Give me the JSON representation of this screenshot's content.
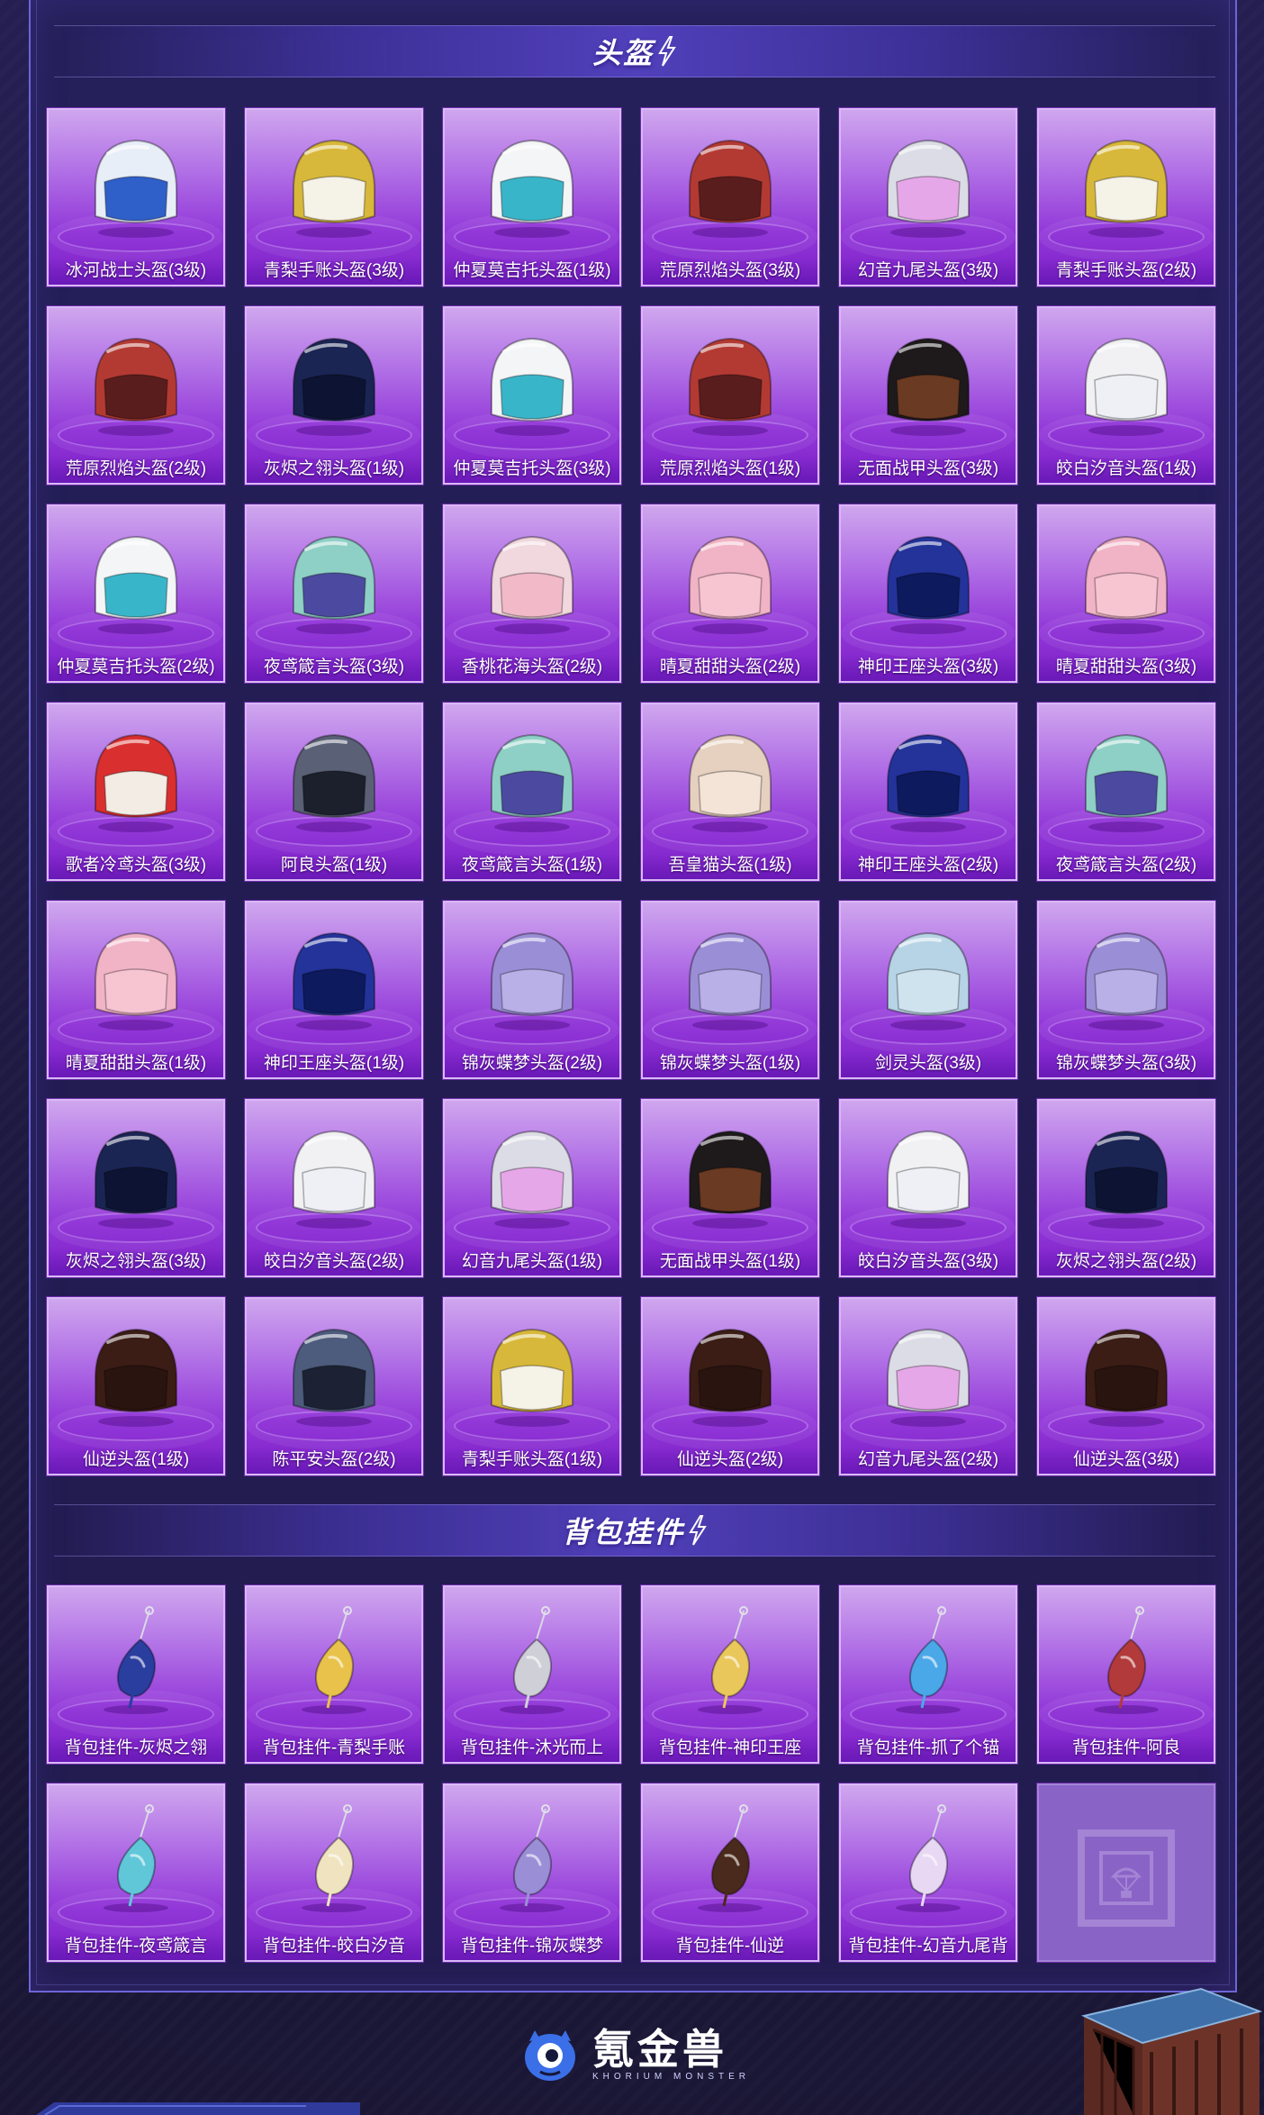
{
  "sections": {
    "helmets": {
      "title": "头盔",
      "items": [
        {
          "label": "冰河战士头盔(3级)",
          "icon": "helmet-icon",
          "color": "#2f5fc8",
          "shell": "#e8eef7"
        },
        {
          "label": "青梨手账头盔(3级)",
          "icon": "helmet-icon",
          "color": "#f5f2e8",
          "shell": "#d8b83a"
        },
        {
          "label": "仲夏莫吉托头盔(1级)",
          "icon": "helmet-icon",
          "color": "#39b5c9",
          "shell": "#f4f5f7"
        },
        {
          "label": "荒原烈焰头盔(3级)",
          "icon": "helmet-icon",
          "color": "#5a1d1d",
          "shell": "#b33a33"
        },
        {
          "label": "幻音九尾头盔(3级)",
          "icon": "helmet-icon",
          "color": "#e6a7e9",
          "shell": "#dcdce6"
        },
        {
          "label": "青梨手账头盔(2级)",
          "icon": "helmet-icon",
          "color": "#f5f2e8",
          "shell": "#d8b83a"
        },
        {
          "label": "荒原烈焰头盔(2级)",
          "icon": "helmet-icon",
          "color": "#5a1d1d",
          "shell": "#b33a33"
        },
        {
          "label": "灰烬之翎头盔(1级)",
          "icon": "helmet-icon",
          "color": "#0d1433",
          "shell": "#1b2554"
        },
        {
          "label": "仲夏莫吉托头盔(3级)",
          "icon": "helmet-icon",
          "color": "#39b5c9",
          "shell": "#f4f5f7"
        },
        {
          "label": "荒原烈焰头盔(1级)",
          "icon": "helmet-icon",
          "color": "#5a1d1d",
          "shell": "#b33a33"
        },
        {
          "label": "无面战甲头盔(3级)",
          "icon": "helmet-icon",
          "color": "#6b3a22",
          "shell": "#1e1a1c"
        },
        {
          "label": "皎白汐音头盔(1级)",
          "icon": "helmet-icon",
          "color": "#eef0f6",
          "shell": "#f1f1f4"
        },
        {
          "label": "仲夏莫吉托头盔(2级)",
          "icon": "helmet-icon",
          "color": "#39b5c9",
          "shell": "#f4f5f7"
        },
        {
          "label": "夜鸢箴言头盔(3级)",
          "icon": "helmet-icon",
          "color": "#4b4aa0",
          "shell": "#8fd0c6"
        },
        {
          "label": "香桃花海头盔(2级)",
          "icon": "helmet-icon",
          "color": "#f2b9c8",
          "shell": "#f1d7de"
        },
        {
          "label": "晴夏甜甜头盔(2级)",
          "icon": "helmet-icon",
          "color": "#f7c4d2",
          "shell": "#f1b3c6"
        },
        {
          "label": "神印王座头盔(3级)",
          "icon": "helmet-icon",
          "color": "#0d1a5e",
          "shell": "#23339a"
        },
        {
          "label": "晴夏甜甜头盔(3级)",
          "icon": "helmet-icon",
          "color": "#f7c4d2",
          "shell": "#f1b3c6"
        },
        {
          "label": "歌者冷鸢头盔(3级)",
          "icon": "helmet-icon",
          "color": "#f2ece4",
          "shell": "#d9302f"
        },
        {
          "label": "阿良头盔(1级)",
          "icon": "helmet-icon",
          "color": "#1c1f2c",
          "shell": "#5a6075"
        },
        {
          "label": "夜鸢箴言头盔(1级)",
          "icon": "helmet-icon",
          "color": "#4b4aa0",
          "shell": "#8fd0c6"
        },
        {
          "label": "吾皇猫头盔(1级)",
          "icon": "helmet-icon",
          "color": "#f4e4d8",
          "shell": "#e6d0bf"
        },
        {
          "label": "神印王座头盔(2级)",
          "icon": "helmet-icon",
          "color": "#0d1a5e",
          "shell": "#23339a"
        },
        {
          "label": "夜鸢箴言头盔(2级)",
          "icon": "helmet-icon",
          "color": "#4b4aa0",
          "shell": "#8fd0c6"
        },
        {
          "label": "晴夏甜甜头盔(1级)",
          "icon": "helmet-icon",
          "color": "#f7c4d2",
          "shell": "#f1b3c6"
        },
        {
          "label": "神印王座头盔(1级)",
          "icon": "helmet-icon",
          "color": "#0d1a5e",
          "shell": "#23339a"
        },
        {
          "label": "锦灰蝶梦头盔(2级)",
          "icon": "helmet-icon",
          "color": "#b9b0e8",
          "shell": "#9a8fd6"
        },
        {
          "label": "锦灰蝶梦头盔(1级)",
          "icon": "helmet-icon",
          "color": "#b9b0e8",
          "shell": "#9a8fd6"
        },
        {
          "label": "剑灵头盔(3级)",
          "icon": "helmet-icon",
          "color": "#cfe3ef",
          "shell": "#b7d4e6"
        },
        {
          "label": "锦灰蝶梦头盔(3级)",
          "icon": "helmet-icon",
          "color": "#b9b0e8",
          "shell": "#9a8fd6"
        },
        {
          "label": "灰烬之翎头盔(3级)",
          "icon": "helmet-icon",
          "color": "#0d1433",
          "shell": "#1b2554"
        },
        {
          "label": "皎白汐音头盔(2级)",
          "icon": "helmet-icon",
          "color": "#eef0f6",
          "shell": "#f1f1f4"
        },
        {
          "label": "幻音九尾头盔(1级)",
          "icon": "helmet-icon",
          "color": "#e6a7e9",
          "shell": "#dcdce6"
        },
        {
          "label": "无面战甲头盔(1级)",
          "icon": "helmet-icon",
          "color": "#6b3a22",
          "shell": "#1e1a1c"
        },
        {
          "label": "皎白汐音头盔(3级)",
          "icon": "helmet-icon",
          "color": "#eef0f6",
          "shell": "#f1f1f4"
        },
        {
          "label": "灰烬之翎头盔(2级)",
          "icon": "helmet-icon",
          "color": "#0d1433",
          "shell": "#1b2554"
        },
        {
          "label": "仙逆头盔(1级)",
          "icon": "helmet-icon",
          "color": "#2a1410",
          "shell": "#3b1d15"
        },
        {
          "label": "陈平安头盔(2级)",
          "icon": "helmet-icon",
          "color": "#1c2233",
          "shell": "#4d5b7c"
        },
        {
          "label": "青梨手账头盔(1级)",
          "icon": "helmet-icon",
          "color": "#f5f2e8",
          "shell": "#d8b83a"
        },
        {
          "label": "仙逆头盔(2级)",
          "icon": "helmet-icon",
          "color": "#2a1410",
          "shell": "#3b1d15"
        },
        {
          "label": "幻音九尾头盔(2级)",
          "icon": "helmet-icon",
          "color": "#e6a7e9",
          "shell": "#dcdce6"
        },
        {
          "label": "仙逆头盔(3级)",
          "icon": "helmet-icon",
          "color": "#2a1410",
          "shell": "#3b1d15"
        }
      ]
    },
    "charms": {
      "title": "背包挂件",
      "items": [
        {
          "label": "背包挂件-灰烬之翎",
          "icon": "charm-icon",
          "color": "#2a3ea0"
        },
        {
          "label": "背包挂件-青梨手账",
          "icon": "charm-icon",
          "color": "#e8c24a"
        },
        {
          "label": "背包挂件-沐光而上",
          "icon": "charm-icon",
          "color": "#cfcfd8"
        },
        {
          "label": "背包挂件-神印王座",
          "icon": "charm-icon",
          "color": "#e9c75a"
        },
        {
          "label": "背包挂件-抓了个锚",
          "icon": "charm-icon",
          "color": "#4aa8e8"
        },
        {
          "label": "背包挂件-阿良",
          "icon": "charm-icon",
          "color": "#b23a3a"
        },
        {
          "label": "背包挂件-夜鸢箴言",
          "icon": "charm-icon",
          "color": "#5fc7d8"
        },
        {
          "label": "背包挂件-皎白汐音",
          "icon": "charm-icon",
          "color": "#f0e4c0"
        },
        {
          "label": "背包挂件-锦灰蝶梦",
          "icon": "charm-icon",
          "color": "#9a8fd6"
        },
        {
          "label": "背包挂件-仙逆",
          "icon": "charm-icon",
          "color": "#4a2a1c"
        },
        {
          "label": "背包挂件-幻音九尾背",
          "icon": "charm-icon",
          "color": "#e8d8f4"
        }
      ],
      "placeholder_icon": "airdrop-crate-icon"
    }
  },
  "footer": {
    "brand_name": "氪金兽",
    "brand_sub": "KHORIUM MONSTER",
    "logo_icon": "monster-logo-icon"
  },
  "colors": {
    "card_top": "#cfa6ee",
    "card_bottom": "#7d1fc8",
    "panel": "#23205a",
    "accent": "#6e64d8"
  }
}
